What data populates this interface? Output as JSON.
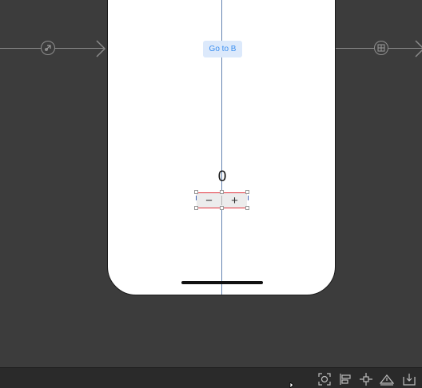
{
  "scene": {
    "goto_button_label": "Go to B",
    "count_value": "0",
    "stepper": {
      "minus": "−",
      "plus": "+"
    }
  },
  "colors": {
    "canvas": "#3c3c3c",
    "accent": "#3a8ef0",
    "selection": "#e0323c",
    "guide": "#4a6fa5"
  },
  "toolbar": {
    "items": [
      {
        "name": "update-frames-icon"
      },
      {
        "name": "align-icon"
      },
      {
        "name": "add-constraints-icon"
      },
      {
        "name": "resolve-issues-icon"
      },
      {
        "name": "embed-in-icon"
      }
    ]
  }
}
